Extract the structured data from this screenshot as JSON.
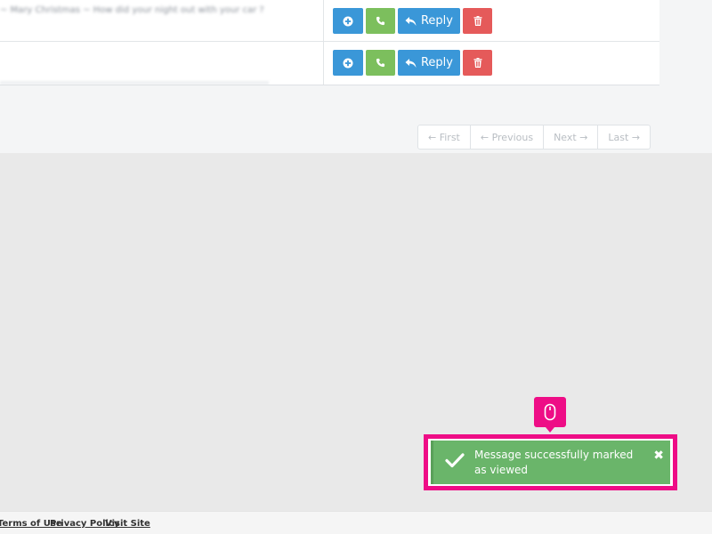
{
  "table": {
    "rows": [
      {
        "message": "~ Mary Christmas ~ How did your night out with your car ?",
        "reply_label": "Reply"
      },
      {
        "message": "",
        "reply_label": "Reply"
      }
    ]
  },
  "pagination": {
    "first": "← First",
    "previous": "← Previous",
    "next": "Next →",
    "last": "Last →"
  },
  "toast": {
    "message": "Message successfully marked as viewed",
    "close_glyph": "✖"
  },
  "footer": {
    "terms": "Terms of Use",
    "privacy": "Privacy Policy",
    "visit": "Visit Site"
  },
  "colors": {
    "primary": "#3a97d8",
    "success": "#7cbf5d",
    "danger": "#e55a5a",
    "toast_bg": "#6ab56a",
    "highlight": "#ee0d86"
  },
  "icons": {
    "add": "plus-circle-icon",
    "call": "phone-icon",
    "reply": "reply-arrow-icon",
    "delete": "trash-icon",
    "toast": "checkmark-icon",
    "cursor": "mouse-icon"
  }
}
